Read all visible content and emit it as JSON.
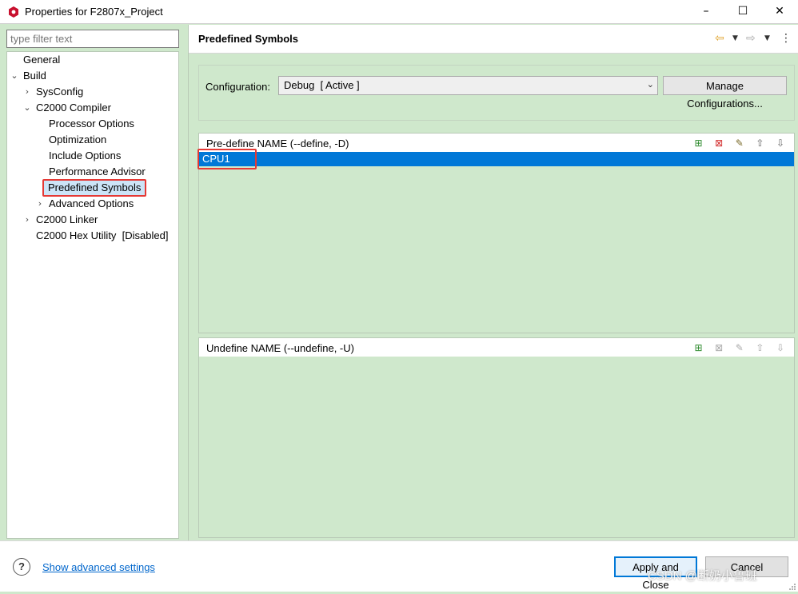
{
  "window": {
    "title": "Properties for F2807x_Project",
    "minimize_glyph": "–",
    "maximize_glyph": "☐",
    "close_glyph": "✕"
  },
  "colors": {
    "accent": "#0078d7",
    "panel_bg": "#cfe8cc",
    "highlight_red": "#e53935"
  },
  "sidebar": {
    "filter_placeholder": "type filter text",
    "items": [
      {
        "label": "General",
        "depth": 0,
        "expander": ""
      },
      {
        "label": "Build",
        "depth": 0,
        "expander": "expanded"
      },
      {
        "label": "SysConfig",
        "depth": 1,
        "expander": "collapsed"
      },
      {
        "label": "C2000 Compiler",
        "depth": 1,
        "expander": "expanded"
      },
      {
        "label": "Processor Options",
        "depth": 2,
        "expander": ""
      },
      {
        "label": "Optimization",
        "depth": 2,
        "expander": ""
      },
      {
        "label": "Include Options",
        "depth": 2,
        "expander": ""
      },
      {
        "label": "Performance Advisor",
        "depth": 2,
        "expander": ""
      },
      {
        "label": "Predefined Symbols",
        "depth": 2,
        "expander": "",
        "selected": true
      },
      {
        "label": "Advanced Options",
        "depth": 2,
        "expander": "collapsed"
      },
      {
        "label": "C2000 Linker",
        "depth": 1,
        "expander": "collapsed"
      },
      {
        "label": "C2000 Hex Utility  [Disabled]",
        "depth": 1,
        "expander": ""
      }
    ]
  },
  "page": {
    "title": "Predefined Symbols",
    "nav_icons": [
      "back-arrow-icon",
      "chevron-down-icon",
      "forward-arrow-icon",
      "chevron-down-icon",
      "more-menu-icon"
    ]
  },
  "configuration": {
    "label": "Configuration:",
    "selected_value": "Debug  [ Active ]",
    "manage_button": "Manage Configurations..."
  },
  "predefine_panel": {
    "title": "Pre-define NAME (--define, -D)",
    "items": [
      "CPU1"
    ],
    "selected_index": 0,
    "toolbar": [
      "add-icon",
      "delete-icon",
      "edit-icon",
      "move-up-icon",
      "move-down-icon"
    ]
  },
  "undefine_panel": {
    "title": "Undefine NAME (--undefine, -U)",
    "items": [],
    "toolbar": [
      "add-icon",
      "delete-icon",
      "edit-icon",
      "move-up-icon",
      "move-down-icon"
    ]
  },
  "footer": {
    "help_glyph": "?",
    "advanced_link": "Show advanced settings",
    "apply_button": "Apply and Close",
    "cancel_button": "Cancel",
    "watermark": "CSDN @断奶小鲁班"
  }
}
